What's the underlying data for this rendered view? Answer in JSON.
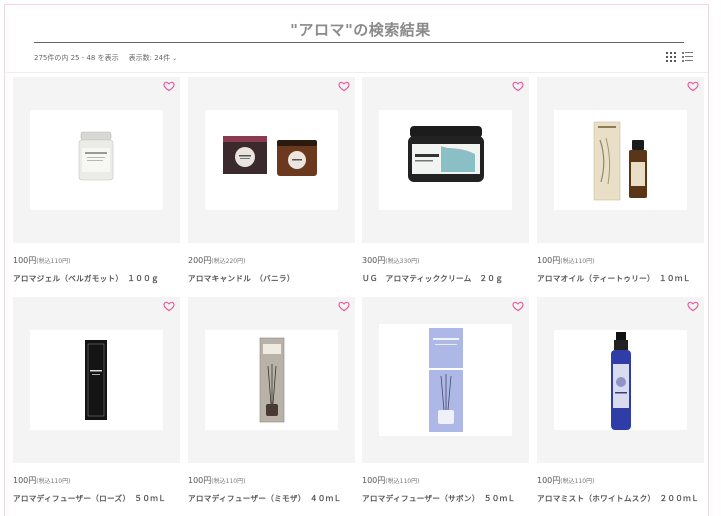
{
  "search": {
    "title": "\"アロマ\"の検索結果",
    "result_count": "275件の内 25 - 48 を表示",
    "per_page": "表示数: 24件",
    "per_page_chevron": "⌄"
  },
  "view": {
    "grid_icon": "grid-view-icon",
    "list_icon": "list-view-icon"
  },
  "colors": {
    "heart": "#e0559b",
    "photo_bg": "#f4f4f4"
  },
  "products": [
    {
      "price": "100円",
      "tax": "(税込110円)",
      "name": "アロマジェル（ベルガモット）　１００ｇ",
      "image": "jar-gel"
    },
    {
      "price": "200円",
      "tax": "(税込220円)",
      "name": "アロマキャンドル　（バニラ）",
      "image": "candle"
    },
    {
      "price": "300円",
      "tax": "(税込330円)",
      "name": "ＵＧ　アロマティッククリーム　２０ｇ",
      "image": "cream-tin"
    },
    {
      "price": "100円",
      "tax": "(税込110円)",
      "name": "アロマオイル（ティートゥリー）　１０ｍＬ",
      "image": "oil-bottle"
    },
    {
      "price": "100円",
      "tax": "(税込110円)",
      "name": "アロマディフューザー（ローズ）　５０ｍＬ",
      "image": "diffuser-black"
    },
    {
      "price": "100円",
      "tax": "(税込110円)",
      "name": "アロマディフューザー（ミモザ）　４０ｍＬ",
      "image": "diffuser-grey"
    },
    {
      "price": "100円",
      "tax": "(税込110円)",
      "name": "アロマディフューザー（サボン）　５０ｍＬ",
      "image": "diffuser-blue"
    },
    {
      "price": "100円",
      "tax": "(税込110円)",
      "name": "アロマミスト（ホワイトムスク）　２００ｍＬ",
      "image": "mist-spray"
    }
  ]
}
